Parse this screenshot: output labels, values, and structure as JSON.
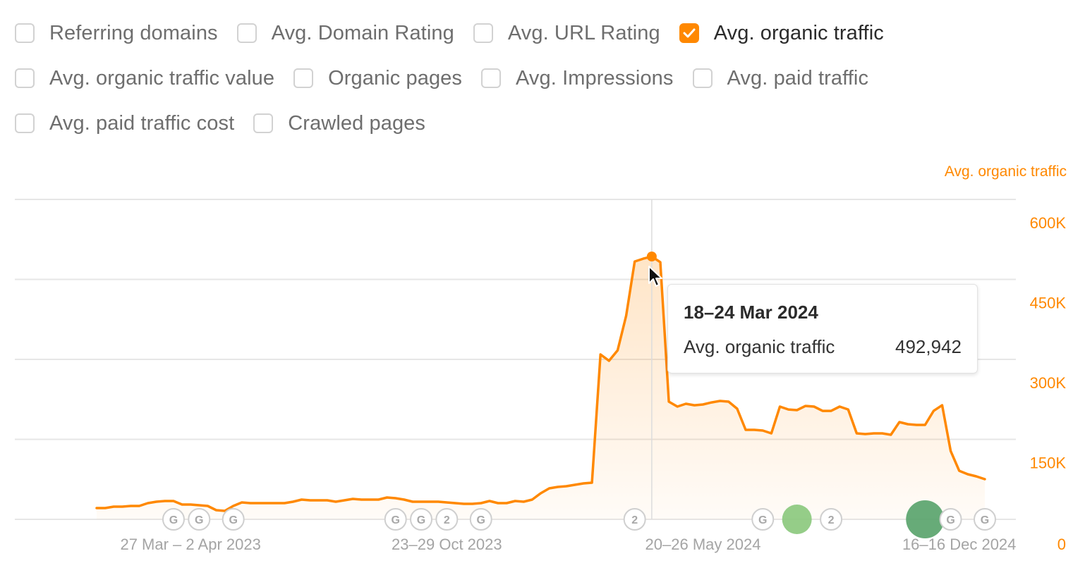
{
  "filters": {
    "rows": [
      [
        {
          "label": "Referring domains",
          "checked": false
        },
        {
          "label": "Avg. Domain Rating",
          "checked": false
        },
        {
          "label": "Avg. URL Rating",
          "checked": false
        },
        {
          "label": "Avg. organic traffic",
          "checked": true
        }
      ],
      [
        {
          "label": "Avg. organic traffic value",
          "checked": false
        },
        {
          "label": "Organic pages",
          "checked": false
        },
        {
          "label": "Avg. Impressions",
          "checked": false
        },
        {
          "label": "Avg. paid traffic",
          "checked": false
        }
      ],
      [
        {
          "label": "Avg. paid traffic cost",
          "checked": false
        },
        {
          "label": "Crawled pages",
          "checked": false
        }
      ]
    ]
  },
  "colors": {
    "series": "#ff8800",
    "checkbox_checked": "#ff8800",
    "grid": "#e6e6e6",
    "marker_light_green": "#8cc97e",
    "marker_dark_green": "#5aa46d"
  },
  "tooltip": {
    "title": "18–24 Mar 2024",
    "metric_label": "Avg. organic traffic",
    "metric_value": "492,942"
  },
  "chart_data": {
    "type": "area",
    "title": "",
    "series_label": "Avg. organic traffic",
    "xlabel": "",
    "ylabel": "Avg. organic traffic",
    "yaxis_position": "right",
    "ylim": [
      0,
      600000
    ],
    "yticks": [
      0,
      150000,
      300000,
      450000,
      600000
    ],
    "ytick_labels": [
      "0",
      "150K",
      "300K",
      "450K",
      "600K"
    ],
    "x_tick_labels": [
      "27 Mar – 2 Apr 2023",
      "23–29 Oct 2023",
      "20–26 May 2024",
      "16–16 Dec 2024"
    ],
    "x_tick_indices": [
      11,
      41,
      71,
      101
    ],
    "grid": true,
    "legend": "none",
    "highlight_index": 65,
    "series": [
      {
        "name": "Avg. organic traffic",
        "values": [
          21100,
          21100,
          23800,
          23800,
          25100,
          25100,
          30400,
          33000,
          34400,
          34400,
          27700,
          27700,
          26400,
          25100,
          17200,
          15900,
          25100,
          31700,
          30400,
          30400,
          30400,
          30400,
          30400,
          33000,
          37000,
          35700,
          35700,
          35700,
          33000,
          35700,
          38300,
          37000,
          37000,
          37000,
          41000,
          39600,
          37000,
          33000,
          33000,
          33000,
          33000,
          31700,
          30400,
          29100,
          29100,
          30400,
          34400,
          30400,
          30400,
          34400,
          33000,
          37000,
          48900,
          58200,
          60800,
          62100,
          64700,
          67400,
          68700,
          309200,
          297300,
          317100,
          381900,
          483600,
          488900,
          492942,
          482300,
          220700,
          211400,
          216700,
          214000,
          215400,
          219300,
          222000,
          220700,
          207500,
          167800,
          167800,
          166500,
          161200,
          211400,
          206100,
          204800,
          212700,
          211400,
          203400,
          203400,
          211400,
          206100,
          161200,
          159900,
          161200,
          161200,
          158600,
          182400,
          178400,
          177100,
          177100,
          203400,
          214000,
          128100,
          91100,
          84600,
          80600,
          75300
        ]
      }
    ],
    "event_markers": [
      {
        "index": 9,
        "label": "G",
        "kind": "google-update"
      },
      {
        "index": 12,
        "label": "G",
        "kind": "google-update"
      },
      {
        "index": 16,
        "label": "G",
        "kind": "google-update"
      },
      {
        "index": 35,
        "label": "G",
        "kind": "google-update"
      },
      {
        "index": 38,
        "label": "G",
        "kind": "google-update"
      },
      {
        "index": 41,
        "label": "2",
        "kind": "grouped-updates"
      },
      {
        "index": 45,
        "label": "G",
        "kind": "google-update"
      },
      {
        "index": 63,
        "label": "2",
        "kind": "grouped-updates"
      },
      {
        "index": 78,
        "label": "G",
        "kind": "google-update"
      },
      {
        "index": 86,
        "label": "2",
        "kind": "grouped-updates"
      },
      {
        "index": 100,
        "label": "G",
        "kind": "google-update"
      },
      {
        "index": 104,
        "label": "G",
        "kind": "google-update"
      }
    ],
    "annotation_bubbles": [
      {
        "index": 82,
        "size": "small",
        "color": "light-green"
      },
      {
        "index": 97,
        "size": "large",
        "color": "dark-green"
      }
    ]
  }
}
